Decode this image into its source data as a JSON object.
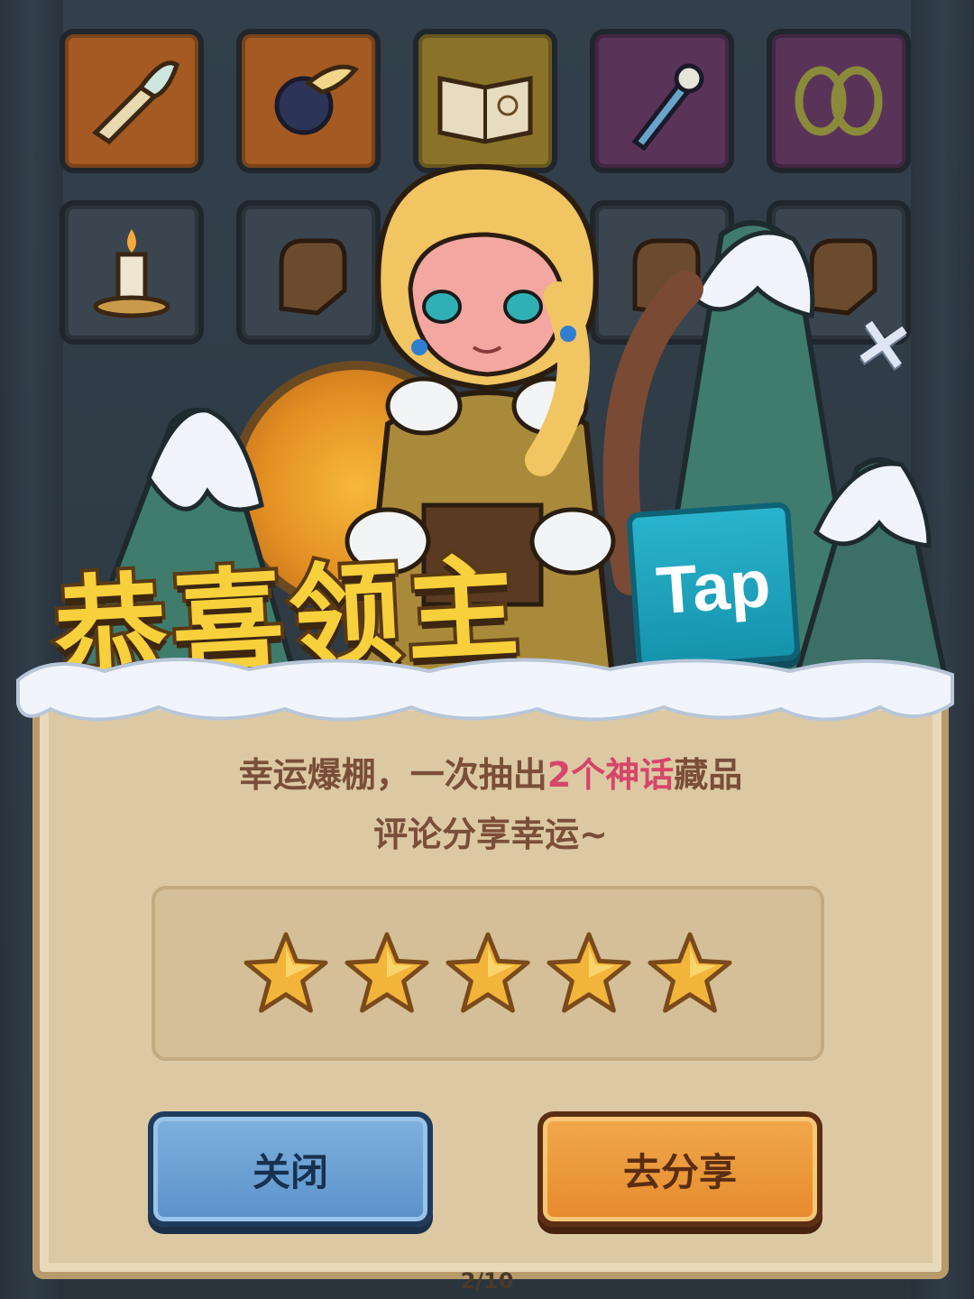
{
  "inventory": {
    "row1": [
      {
        "rarity": "orange",
        "icon": "feather-horn-icon"
      },
      {
        "rarity": "orange",
        "icon": "winged-orb-icon"
      },
      {
        "rarity": "gold",
        "icon": "spellbook-icon"
      },
      {
        "rarity": "purple",
        "icon": "ice-dagger-icon"
      },
      {
        "rarity": "purple",
        "icon": "thorn-chain-icon"
      }
    ],
    "row2": [
      {
        "rarity": "dark",
        "icon": "candle-icon"
      },
      {
        "rarity": "dark",
        "icon": "glove-icon"
      },
      {
        "rarity": "dark",
        "icon": "glove-icon"
      },
      {
        "rarity": "dark",
        "icon": "glove-icon"
      },
      {
        "rarity": "dark",
        "icon": "glove-icon"
      }
    ]
  },
  "title": "恭喜领主",
  "badge": "Tap",
  "message": {
    "line1_prefix": "幸运爆棚，一次抽出",
    "line1_highlight": "2个神话",
    "line1_suffix": "藏品",
    "line2": "评论分享幸运~"
  },
  "rating": {
    "stars_filled": 5,
    "stars_total": 5
  },
  "buttons": {
    "close_label": "关闭",
    "share_label": "去分享"
  },
  "progress_text": "2/10",
  "colors": {
    "highlight": "#d6456a",
    "title_fill": "#f7d03b",
    "close_button": "#5a92c9",
    "share_button": "#e58a2c",
    "panel": "#dcc9a3"
  }
}
